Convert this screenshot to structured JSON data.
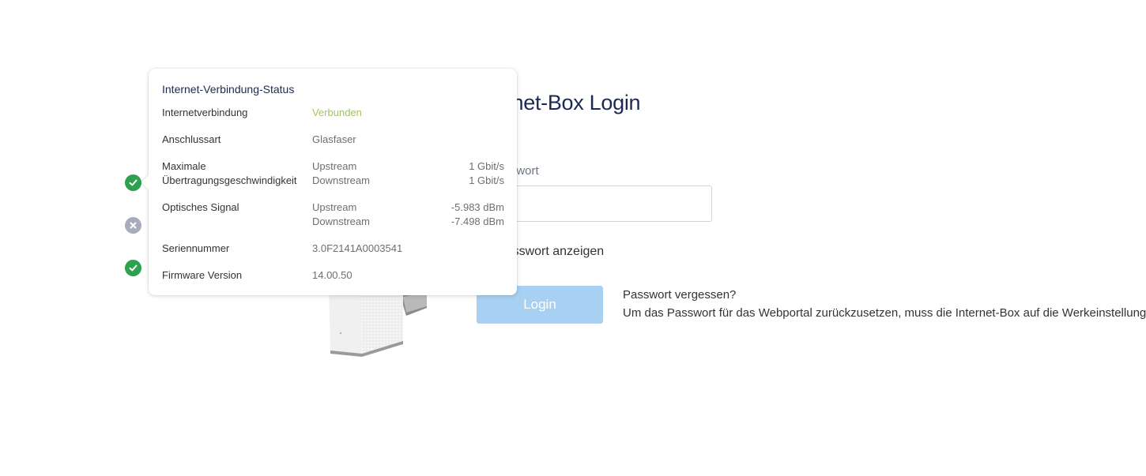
{
  "login": {
    "title": "Internet-Box Login",
    "password_label": "Passwort",
    "password_value": "",
    "show_password_label": "Passwort anzeigen",
    "login_button": "Login",
    "forgot_title": "Passwort vergessen?",
    "forgot_text": "Um das Passwort für das Webportal zurückzusetzen, muss die Internet-Box auf die Werkeinstellungen zurückgesetzt werden."
  },
  "status_icons": [
    {
      "name": "check-icon",
      "state": "ok",
      "color": "#2ca24e"
    },
    {
      "name": "x-icon",
      "state": "fail",
      "color": "#a7acbd"
    },
    {
      "name": "check-icon",
      "state": "ok",
      "color": "#2ca24e"
    }
  ],
  "popover": {
    "title": "Internet-Verbindung-Status",
    "rows": {
      "connection": {
        "label": "Internetverbindung",
        "value": "Verbunden",
        "value_color": "#a4c16a"
      },
      "type": {
        "label": "Anschlussart",
        "value": "Glasfaser"
      },
      "speed": {
        "label_line1": "Maximale",
        "label_line2": "Übertragungsgeschwindigkeit",
        "up_label": "Upstream",
        "up_value": "1 Gbit/s",
        "down_label": "Downstream",
        "down_value": "1 Gbit/s"
      },
      "optical": {
        "label": "Optisches Signal",
        "up_label": "Upstream",
        "up_value": "-5.983 dBm",
        "down_label": "Downstream",
        "down_value": "-7.498 dBm"
      },
      "serial": {
        "label": "Seriennummer",
        "value": "3.0F2141A0003541"
      },
      "firmware": {
        "label": "Firmware Version",
        "value": "14.00.50"
      }
    }
  }
}
